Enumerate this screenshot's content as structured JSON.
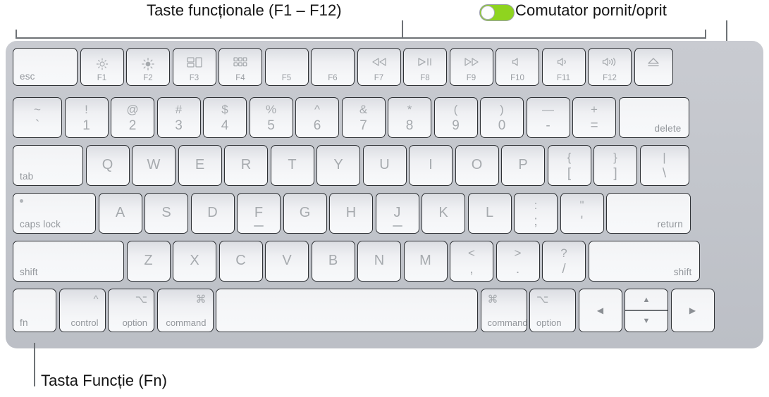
{
  "annotations": {
    "fkeys_label": "Taste funcționale (F1 – F12)",
    "toggle_label": "Comutator pornit/oprit",
    "fn_label": "Tasta Funcție (Fn)",
    "toggle_state": "on",
    "toggle_color": "#8fd41f"
  },
  "keyboard": {
    "rows": [
      {
        "name": "function-row",
        "keys": [
          {
            "id": "esc",
            "main": "esc",
            "style": "text-bl"
          },
          {
            "id": "f1",
            "fn": "F1",
            "icon": "brightness-down-icon",
            "style": "fn"
          },
          {
            "id": "f2",
            "fn": "F2",
            "icon": "brightness-up-icon",
            "style": "fn"
          },
          {
            "id": "f3",
            "fn": "F3",
            "icon": "mission-control-icon",
            "style": "fn"
          },
          {
            "id": "f4",
            "fn": "F4",
            "icon": "launchpad-icon",
            "style": "fn"
          },
          {
            "id": "f5",
            "fn": "F5",
            "icon": "",
            "style": "fn"
          },
          {
            "id": "f6",
            "fn": "F6",
            "icon": "",
            "style": "fn"
          },
          {
            "id": "f7",
            "fn": "F7",
            "icon": "rewind-icon",
            "style": "fn"
          },
          {
            "id": "f8",
            "fn": "F8",
            "icon": "play-pause-icon",
            "style": "fn"
          },
          {
            "id": "f9",
            "fn": "F9",
            "icon": "fast-forward-icon",
            "style": "fn"
          },
          {
            "id": "f10",
            "fn": "F10",
            "icon": "mute-icon",
            "style": "fn"
          },
          {
            "id": "f11",
            "fn": "F11",
            "icon": "volume-down-icon",
            "style": "fn"
          },
          {
            "id": "f12",
            "fn": "F12",
            "icon": "volume-up-icon",
            "style": "fn"
          },
          {
            "id": "eject",
            "fn": "",
            "icon": "eject-icon",
            "style": "fn"
          }
        ]
      },
      {
        "name": "number-row",
        "keys": [
          {
            "id": "grave",
            "upper": "~",
            "lower": "`",
            "style": "dual"
          },
          {
            "id": "1",
            "upper": "!",
            "lower": "1",
            "style": "dual"
          },
          {
            "id": "2",
            "upper": "@",
            "lower": "2",
            "style": "dual"
          },
          {
            "id": "3",
            "upper": "#",
            "lower": "3",
            "style": "dual"
          },
          {
            "id": "4",
            "upper": "$",
            "lower": "4",
            "style": "dual"
          },
          {
            "id": "5",
            "upper": "%",
            "lower": "5",
            "style": "dual"
          },
          {
            "id": "6",
            "upper": "^",
            "lower": "6",
            "style": "dual"
          },
          {
            "id": "7",
            "upper": "&",
            "lower": "7",
            "style": "dual"
          },
          {
            "id": "8",
            "upper": "*",
            "lower": "8",
            "style": "dual"
          },
          {
            "id": "9",
            "upper": "(",
            "lower": "9",
            "style": "dual"
          },
          {
            "id": "0",
            "upper": ")",
            "lower": "0",
            "style": "dual"
          },
          {
            "id": "minus",
            "upper": "—",
            "lower": "-",
            "style": "dual"
          },
          {
            "id": "equal",
            "upper": "+",
            "lower": "=",
            "style": "dual"
          },
          {
            "id": "delete",
            "main": "delete",
            "style": "text-br"
          }
        ]
      },
      {
        "name": "qwerty-row",
        "keys": [
          {
            "id": "tab",
            "main": "tab",
            "style": "text-bl"
          },
          {
            "id": "q",
            "letter": "Q",
            "style": "letter"
          },
          {
            "id": "w",
            "letter": "W",
            "style": "letter"
          },
          {
            "id": "e",
            "letter": "E",
            "style": "letter"
          },
          {
            "id": "r",
            "letter": "R",
            "style": "letter"
          },
          {
            "id": "t",
            "letter": "T",
            "style": "letter"
          },
          {
            "id": "y",
            "letter": "Y",
            "style": "letter"
          },
          {
            "id": "u",
            "letter": "U",
            "style": "letter"
          },
          {
            "id": "i",
            "letter": "I",
            "style": "letter"
          },
          {
            "id": "o",
            "letter": "O",
            "style": "letter"
          },
          {
            "id": "p",
            "letter": "P",
            "style": "letter"
          },
          {
            "id": "bracket-left",
            "upper": "{",
            "lower": "[",
            "style": "dual"
          },
          {
            "id": "bracket-right",
            "upper": "}",
            "lower": "]",
            "style": "dual"
          },
          {
            "id": "backslash",
            "upper": "|",
            "lower": "\\",
            "style": "dual"
          }
        ]
      },
      {
        "name": "home-row",
        "keys": [
          {
            "id": "caps-lock",
            "main": "caps lock",
            "style": "caps"
          },
          {
            "id": "a",
            "letter": "A",
            "style": "letter"
          },
          {
            "id": "s",
            "letter": "S",
            "style": "letter"
          },
          {
            "id": "d",
            "letter": "D",
            "style": "letter"
          },
          {
            "id": "f",
            "letter": "F",
            "style": "letter",
            "bump": true
          },
          {
            "id": "g",
            "letter": "G",
            "style": "letter"
          },
          {
            "id": "h",
            "letter": "H",
            "style": "letter"
          },
          {
            "id": "j",
            "letter": "J",
            "style": "letter",
            "bump": true
          },
          {
            "id": "k",
            "letter": "K",
            "style": "letter"
          },
          {
            "id": "l",
            "letter": "L",
            "style": "letter"
          },
          {
            "id": "semicolon",
            "upper": ":",
            "lower": ";",
            "style": "dual"
          },
          {
            "id": "quote",
            "upper": "\"",
            "lower": "'",
            "style": "dual"
          },
          {
            "id": "return",
            "main": "return",
            "style": "text-br"
          }
        ]
      },
      {
        "name": "shift-row",
        "keys": [
          {
            "id": "shift-left",
            "main": "shift",
            "style": "text-bl"
          },
          {
            "id": "z",
            "letter": "Z",
            "style": "letter"
          },
          {
            "id": "x",
            "letter": "X",
            "style": "letter"
          },
          {
            "id": "c",
            "letter": "C",
            "style": "letter"
          },
          {
            "id": "v",
            "letter": "V",
            "style": "letter"
          },
          {
            "id": "b",
            "letter": "B",
            "style": "letter"
          },
          {
            "id": "n",
            "letter": "N",
            "style": "letter"
          },
          {
            "id": "m",
            "letter": "M",
            "style": "letter"
          },
          {
            "id": "comma",
            "upper": "<",
            "lower": ",",
            "style": "dual"
          },
          {
            "id": "period",
            "upper": ">",
            "lower": ".",
            "style": "dual"
          },
          {
            "id": "slash",
            "upper": "?",
            "lower": "/",
            "style": "dual"
          },
          {
            "id": "shift-right",
            "main": "shift",
            "style": "text-br"
          }
        ]
      },
      {
        "name": "bottom-row",
        "keys": [
          {
            "id": "fn",
            "main": "fn",
            "style": "text-bl"
          },
          {
            "id": "control",
            "main": "control",
            "symbol": "^",
            "style": "mod"
          },
          {
            "id": "option-left",
            "main": "option",
            "symbol": "⌥",
            "style": "mod"
          },
          {
            "id": "command-left",
            "main": "command",
            "symbol": "⌘",
            "style": "mod"
          },
          {
            "id": "space",
            "main": "",
            "style": "blank"
          },
          {
            "id": "command-right",
            "main": "command",
            "symbol": "⌘",
            "style": "mod-left"
          },
          {
            "id": "option-right",
            "main": "option",
            "symbol": "⌥",
            "style": "mod-left"
          },
          {
            "id": "arrow-left",
            "main": "◀",
            "style": "arrow"
          },
          {
            "id": "arrow-updown",
            "up": "▲",
            "down": "▼",
            "style": "updown"
          },
          {
            "id": "arrow-right",
            "main": "▶",
            "style": "arrow"
          }
        ]
      }
    ]
  }
}
